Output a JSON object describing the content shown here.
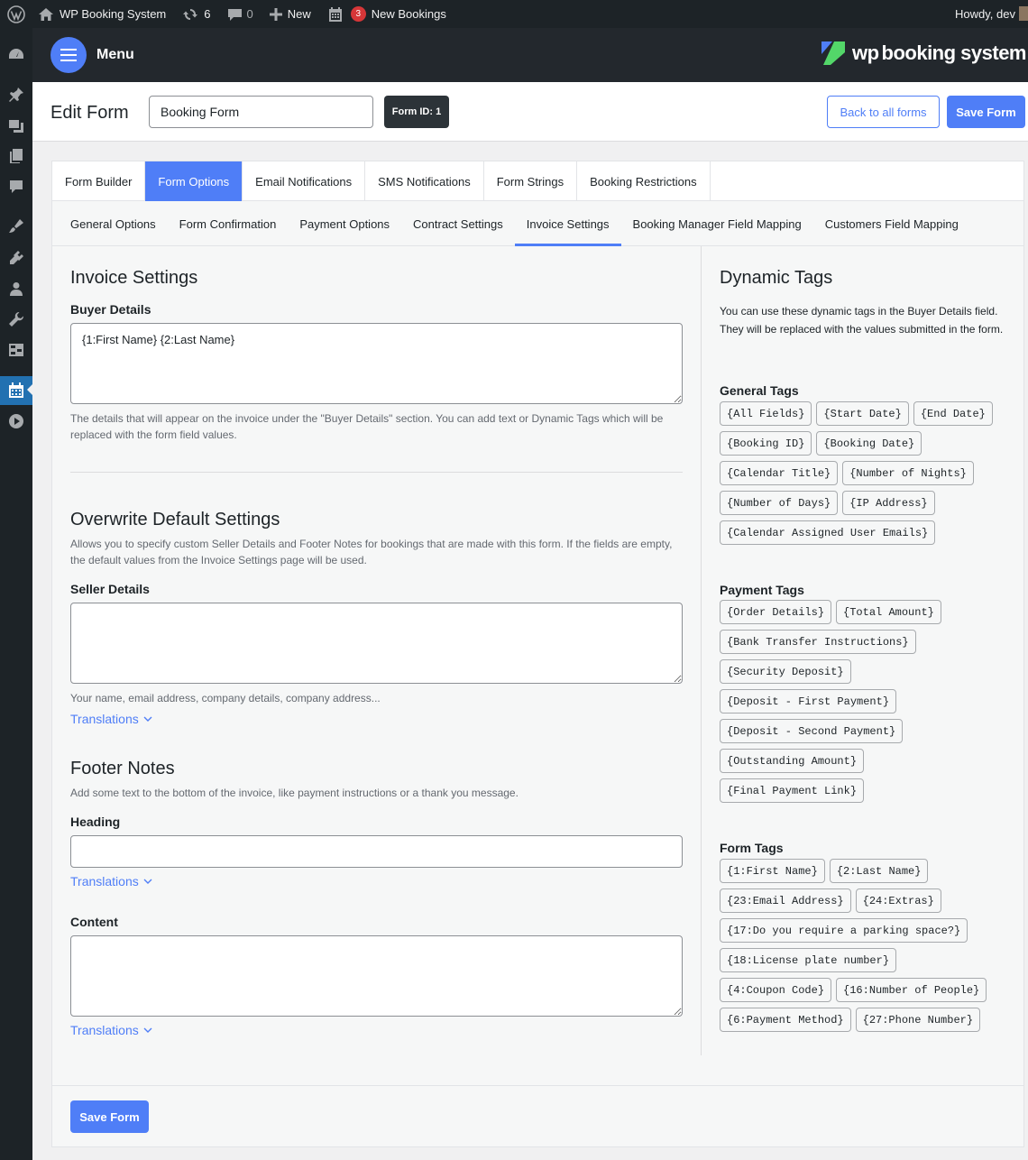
{
  "admin_bar": {
    "site_name": "WP Booking System",
    "updates_count": "6",
    "comments_count": "0",
    "new_label": "New",
    "bookings_count": "3",
    "bookings_label": "New Bookings",
    "howdy": "Howdy, dev"
  },
  "header": {
    "menu_label": "Menu",
    "brand_wp": "wp",
    "brand_rest": "booking system"
  },
  "title_bar": {
    "title": "Edit Form",
    "form_name": "Booking Form",
    "form_id": "Form ID: 1",
    "back_label": "Back to all forms",
    "save_label": "Save Form"
  },
  "tabs": [
    {
      "label": "Form Builder"
    },
    {
      "label": "Form Options"
    },
    {
      "label": "Email Notifications"
    },
    {
      "label": "SMS Notifications"
    },
    {
      "label": "Form Strings"
    },
    {
      "label": "Booking Restrictions"
    }
  ],
  "subtabs": [
    {
      "label": "General Options"
    },
    {
      "label": "Form Confirmation"
    },
    {
      "label": "Payment Options"
    },
    {
      "label": "Contract Settings"
    },
    {
      "label": "Invoice Settings"
    },
    {
      "label": "Booking Manager Field Mapping"
    },
    {
      "label": "Customers Field Mapping"
    }
  ],
  "invoice": {
    "title": "Invoice Settings",
    "buyer_label": "Buyer Details",
    "buyer_value": "{1:First Name} {2:Last Name}",
    "buyer_help": "The details that will appear on the invoice under the \"Buyer Details\" section. You can add text or Dynamic Tags which will be replaced with the form field values."
  },
  "overwrite": {
    "title": "Overwrite Default Settings",
    "description": "Allows you to specify custom Seller Details and Footer Notes for bookings that are made with this form. If the fields are empty, the default values from the Invoice Settings page will be used.",
    "seller_label": "Seller Details",
    "seller_value": "",
    "seller_help": "Your name, email address, company details, company address...",
    "translations": "Translations"
  },
  "footer_notes": {
    "title": "Footer Notes",
    "description": "Add some text to the bottom of the invoice, like payment instructions or a thank you message.",
    "heading_label": "Heading",
    "heading_value": "",
    "content_label": "Content",
    "content_value": "",
    "translations": "Translations"
  },
  "dynamic_tags": {
    "title": "Dynamic Tags",
    "intro": "You can use these dynamic tags in the Buyer Details field. They will be replaced with the values submitted in the form.",
    "general_title": "General Tags",
    "general": [
      "{All Fields}",
      "{Start Date}",
      "{End Date}",
      "{Booking ID}",
      "{Booking Date}",
      "{Calendar Title}",
      "{Number of Nights}",
      "{Number of Days}",
      "{IP Address}",
      "{Calendar Assigned User Emails}"
    ],
    "payment_title": "Payment Tags",
    "payment": [
      "{Order Details}",
      "{Total Amount}",
      "{Bank Transfer Instructions}",
      "{Security Deposit}",
      "{Deposit - First Payment}",
      "{Deposit - Second Payment}",
      "{Outstanding Amount}",
      "{Final Payment Link}"
    ],
    "form_title": "Form Tags",
    "form": [
      "{1:First Name}",
      "{2:Last Name}",
      "{23:Email Address}",
      "{24:Extras}",
      "{17:Do you require a parking space?}",
      "{18:License plate number}",
      "{4:Coupon Code}",
      "{16:Number of People}",
      "{6:Payment Method}",
      "{27:Phone Number}"
    ]
  },
  "footer": {
    "save_label": "Save Form"
  },
  "colors": {
    "accent": "#4f7ef7",
    "admin_bar": "#1d2327",
    "badge": "#d63638"
  }
}
